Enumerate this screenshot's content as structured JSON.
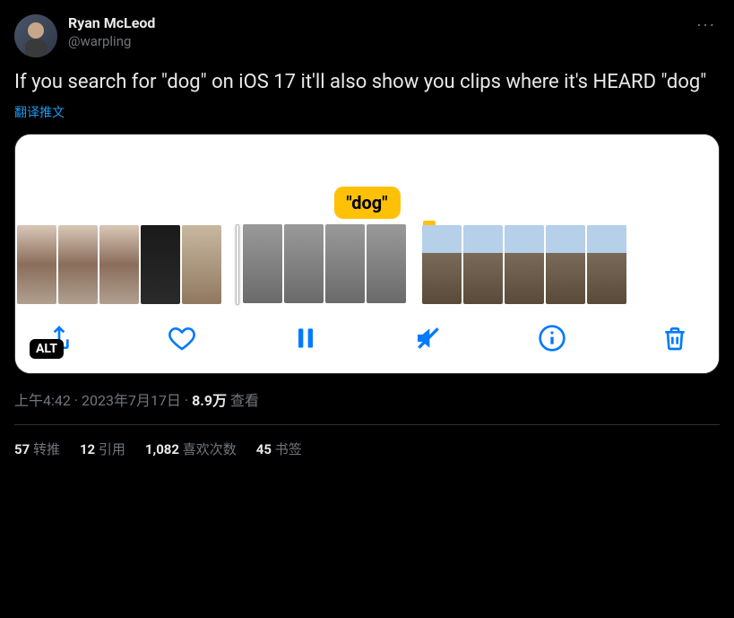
{
  "author": {
    "display_name": "Ryan McLeod",
    "handle": "@warpling"
  },
  "more_menu": "···",
  "tweet_text": "If you search for \"dog\" on iOS 17 it'll also show you clips where it's HEARD \"dog\"",
  "translate_label": "翻译推文",
  "media": {
    "search_term_label": "\"dog\"",
    "alt_badge": "ALT",
    "toolbar_icons": {
      "share": "share-icon",
      "like": "heart-icon",
      "pause": "pause-icon",
      "mute": "mute-icon",
      "info": "info-icon",
      "trash": "trash-icon"
    }
  },
  "meta": {
    "time": "上午4:42",
    "date": "2023年7月17日",
    "separator": " · ",
    "views_count": "8.9万",
    "views_label": " 查看"
  },
  "stats": {
    "retweets": {
      "count": "57",
      "label": " 转推"
    },
    "quotes": {
      "count": "12",
      "label": " 引用"
    },
    "likes": {
      "count": "1,082",
      "label": " 喜欢次数"
    },
    "bookmarks": {
      "count": "45",
      "label": " 书签"
    }
  }
}
